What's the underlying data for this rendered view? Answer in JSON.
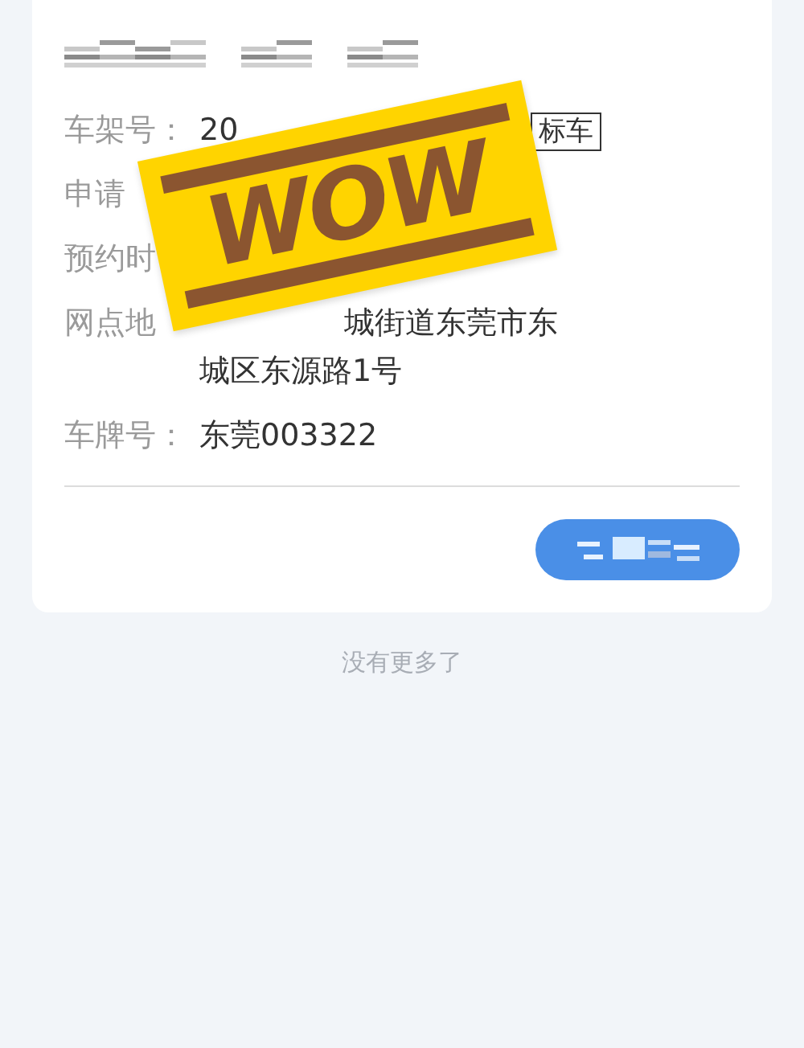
{
  "card": {
    "rows": [
      {
        "kind": "tag",
        "label": "车架号：",
        "value": "20",
        "tag": "标车"
      },
      {
        "kind": "label",
        "label": "申请"
      },
      {
        "kind": "label",
        "label": "预约时"
      },
      {
        "kind": "address",
        "label": "网点地",
        "lines": [
          "城街道东莞市东",
          "城区东源路1号"
        ]
      },
      {
        "kind": "value",
        "label": "车牌号：",
        "value": "东莞003322"
      }
    ]
  },
  "sticker": {
    "text": "WOW"
  },
  "footer": "没有更多了"
}
